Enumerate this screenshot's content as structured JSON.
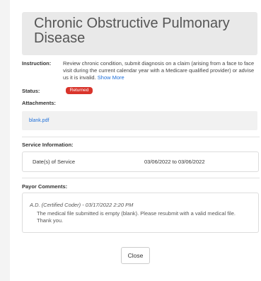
{
  "modal": {
    "title": "Chronic Obstructive Pulmonary Disease",
    "instruction_label": "Instruction:",
    "instruction_text": "Review chronic condition, submit diagnosis on a claim (arising from a face to face visit during the current calendar year with a Medicare qualified provider) or advise us it is invalid.",
    "show_more": "Show More",
    "status_label": "Status:",
    "status_value": "Returned",
    "attachments_label": "Attachments:",
    "attachment_file": "blank.pdf",
    "service_info_label": "Service Information:",
    "service": {
      "label": "Date(s) of Service",
      "value": "03/06/2022 to 03/06/2022"
    },
    "payor_comments_label": "Payor Comments:",
    "comment": {
      "author": "A.D. (Certified Coder)",
      "separator": " - ",
      "timestamp": "03/17/2022 2:20 PM",
      "text": "The medical file submitted is empty (blank). Please resubmit with a valid medical file. Thank you."
    },
    "close_label": "Close"
  },
  "colors": {
    "status_badge": "#d9342b",
    "link": "#1e6fd9",
    "title_bg": "#e9e9e9"
  }
}
